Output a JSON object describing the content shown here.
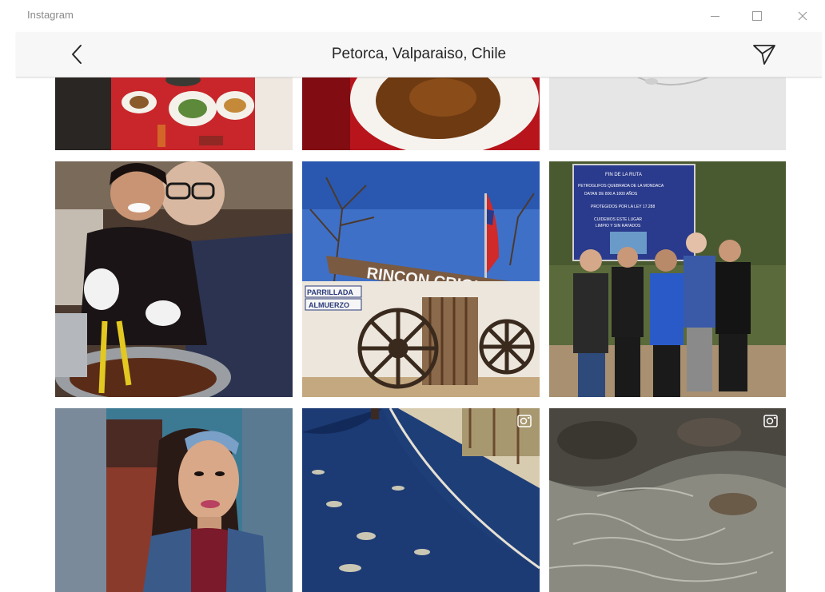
{
  "window": {
    "app_title": "Instagram",
    "controls": {
      "minimize": "minimize-icon",
      "maximize": "maximize-icon",
      "close": "close-icon"
    }
  },
  "header": {
    "title": "Petorca, Valparaiso, Chile",
    "back_icon": "chevron-left-icon",
    "send_icon": "paper-plane-icon"
  },
  "sign_texts": {
    "rincon": "RINCON CRIOLLO",
    "parrillada": "PARRILLADA",
    "almuerzo": "ALMUERZO",
    "ruta_header": "FIN DE LA RUTA",
    "ruta_line1": "PETROGLIFOS QUEBRADA DE LA MONDACA",
    "ruta_line2": "DATAN DE 800 A 1000 AÑOS",
    "ruta_line3": "PROTEGIDOS POR LA LEY 17.288",
    "ruta_line4": "CUIDEMOS ESTE LUGAR",
    "ruta_line5": "LIMPIO Y SIN RAYADOS"
  },
  "posts": [
    {
      "name": "post-food-table",
      "type": "photo"
    },
    {
      "name": "post-soup-bowl",
      "type": "photo"
    },
    {
      "name": "post-white-plate",
      "type": "photo"
    },
    {
      "name": "post-cooking-couple",
      "type": "photo"
    },
    {
      "name": "post-rincon-criollo",
      "type": "photo"
    },
    {
      "name": "post-group-sign",
      "type": "photo"
    },
    {
      "name": "post-selfie-woman",
      "type": "photo"
    },
    {
      "name": "post-country-road",
      "type": "video",
      "badge_icon": "video-camera-icon"
    },
    {
      "name": "post-river-rocks",
      "type": "video",
      "badge_icon": "video-camera-icon"
    }
  ]
}
